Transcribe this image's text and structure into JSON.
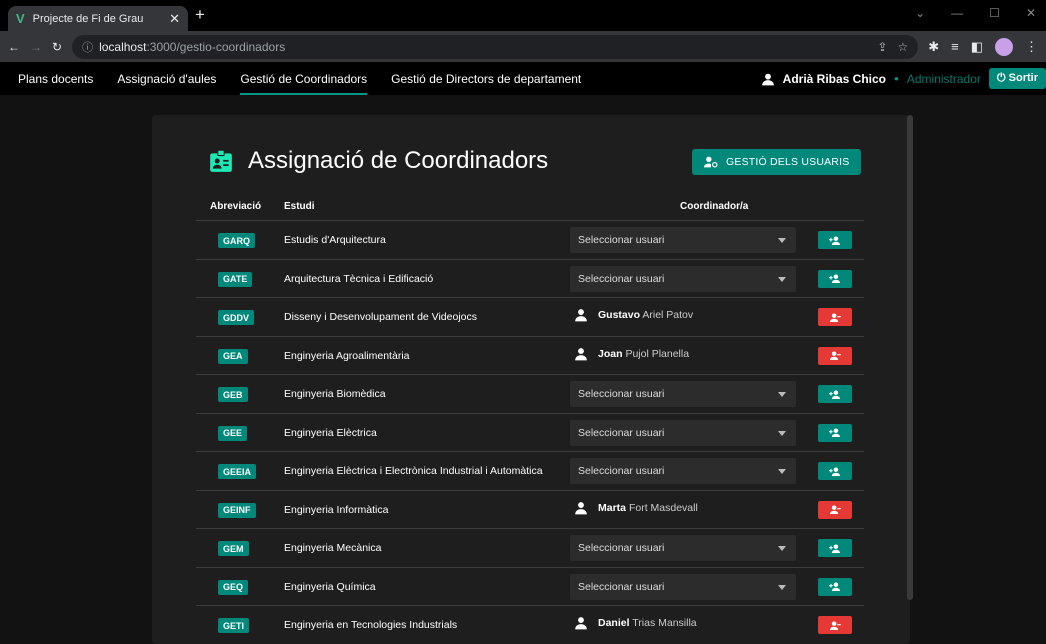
{
  "browser": {
    "tab_title": "Projecte de Fi de Grau",
    "url_host": "localhost",
    "url_path": ":3000/gestio-coordinadors"
  },
  "nav": {
    "items": [
      "Plans docents",
      "Assignació d'aules",
      "Gestió de Coordinadors",
      "Gestió de Directors de departament"
    ],
    "active_index": 2
  },
  "user": {
    "name": "Adrià Ribas Chico",
    "role": "Administrador",
    "logout_label": "Sortir"
  },
  "main": {
    "title": "Assignació de Coordinadors",
    "users_button_label": "GESTIÓ DELS USUARIS",
    "columns": [
      "Abreviació",
      "Estudi",
      "Coordinador/a"
    ],
    "select_placeholder": "Seleccionar usuari",
    "rows": [
      {
        "abbr": "GARQ",
        "estudi": "Estudis d'Arquitectura",
        "coord_first": "",
        "coord_rest": ""
      },
      {
        "abbr": "GATE",
        "estudi": "Arquitectura Tècnica i Edificació",
        "coord_first": "",
        "coord_rest": ""
      },
      {
        "abbr": "GDDV",
        "estudi": "Disseny i Desenvolupament de Videojocs",
        "coord_first": "Gustavo",
        "coord_rest": "Ariel Patov"
      },
      {
        "abbr": "GEA",
        "estudi": "Enginyeria Agroalimentària",
        "coord_first": "Joan",
        "coord_rest": "Pujol Planella"
      },
      {
        "abbr": "GEB",
        "estudi": "Enginyeria Biomèdica",
        "coord_first": "",
        "coord_rest": ""
      },
      {
        "abbr": "GEE",
        "estudi": "Enginyeria Elèctrica",
        "coord_first": "",
        "coord_rest": ""
      },
      {
        "abbr": "GEEIA",
        "estudi": "Enginyeria Elèctrica i Electrònica Industrial i Automàtica",
        "coord_first": "",
        "coord_rest": ""
      },
      {
        "abbr": "GEINF",
        "estudi": "Enginyeria Informàtica",
        "coord_first": "Marta",
        "coord_rest": "Fort Masdevall"
      },
      {
        "abbr": "GEM",
        "estudi": "Enginyeria Mecànica",
        "coord_first": "",
        "coord_rest": ""
      },
      {
        "abbr": "GEQ",
        "estudi": "Enginyeria Química",
        "coord_first": "",
        "coord_rest": ""
      },
      {
        "abbr": "GETI",
        "estudi": "Enginyeria en Tecnologies Industrials",
        "coord_first": "Daniel",
        "coord_rest": "Trias Mansilla"
      }
    ]
  },
  "colors": {
    "accent": "#00897b",
    "danger": "#e53935",
    "card": "#1e1e1e"
  }
}
